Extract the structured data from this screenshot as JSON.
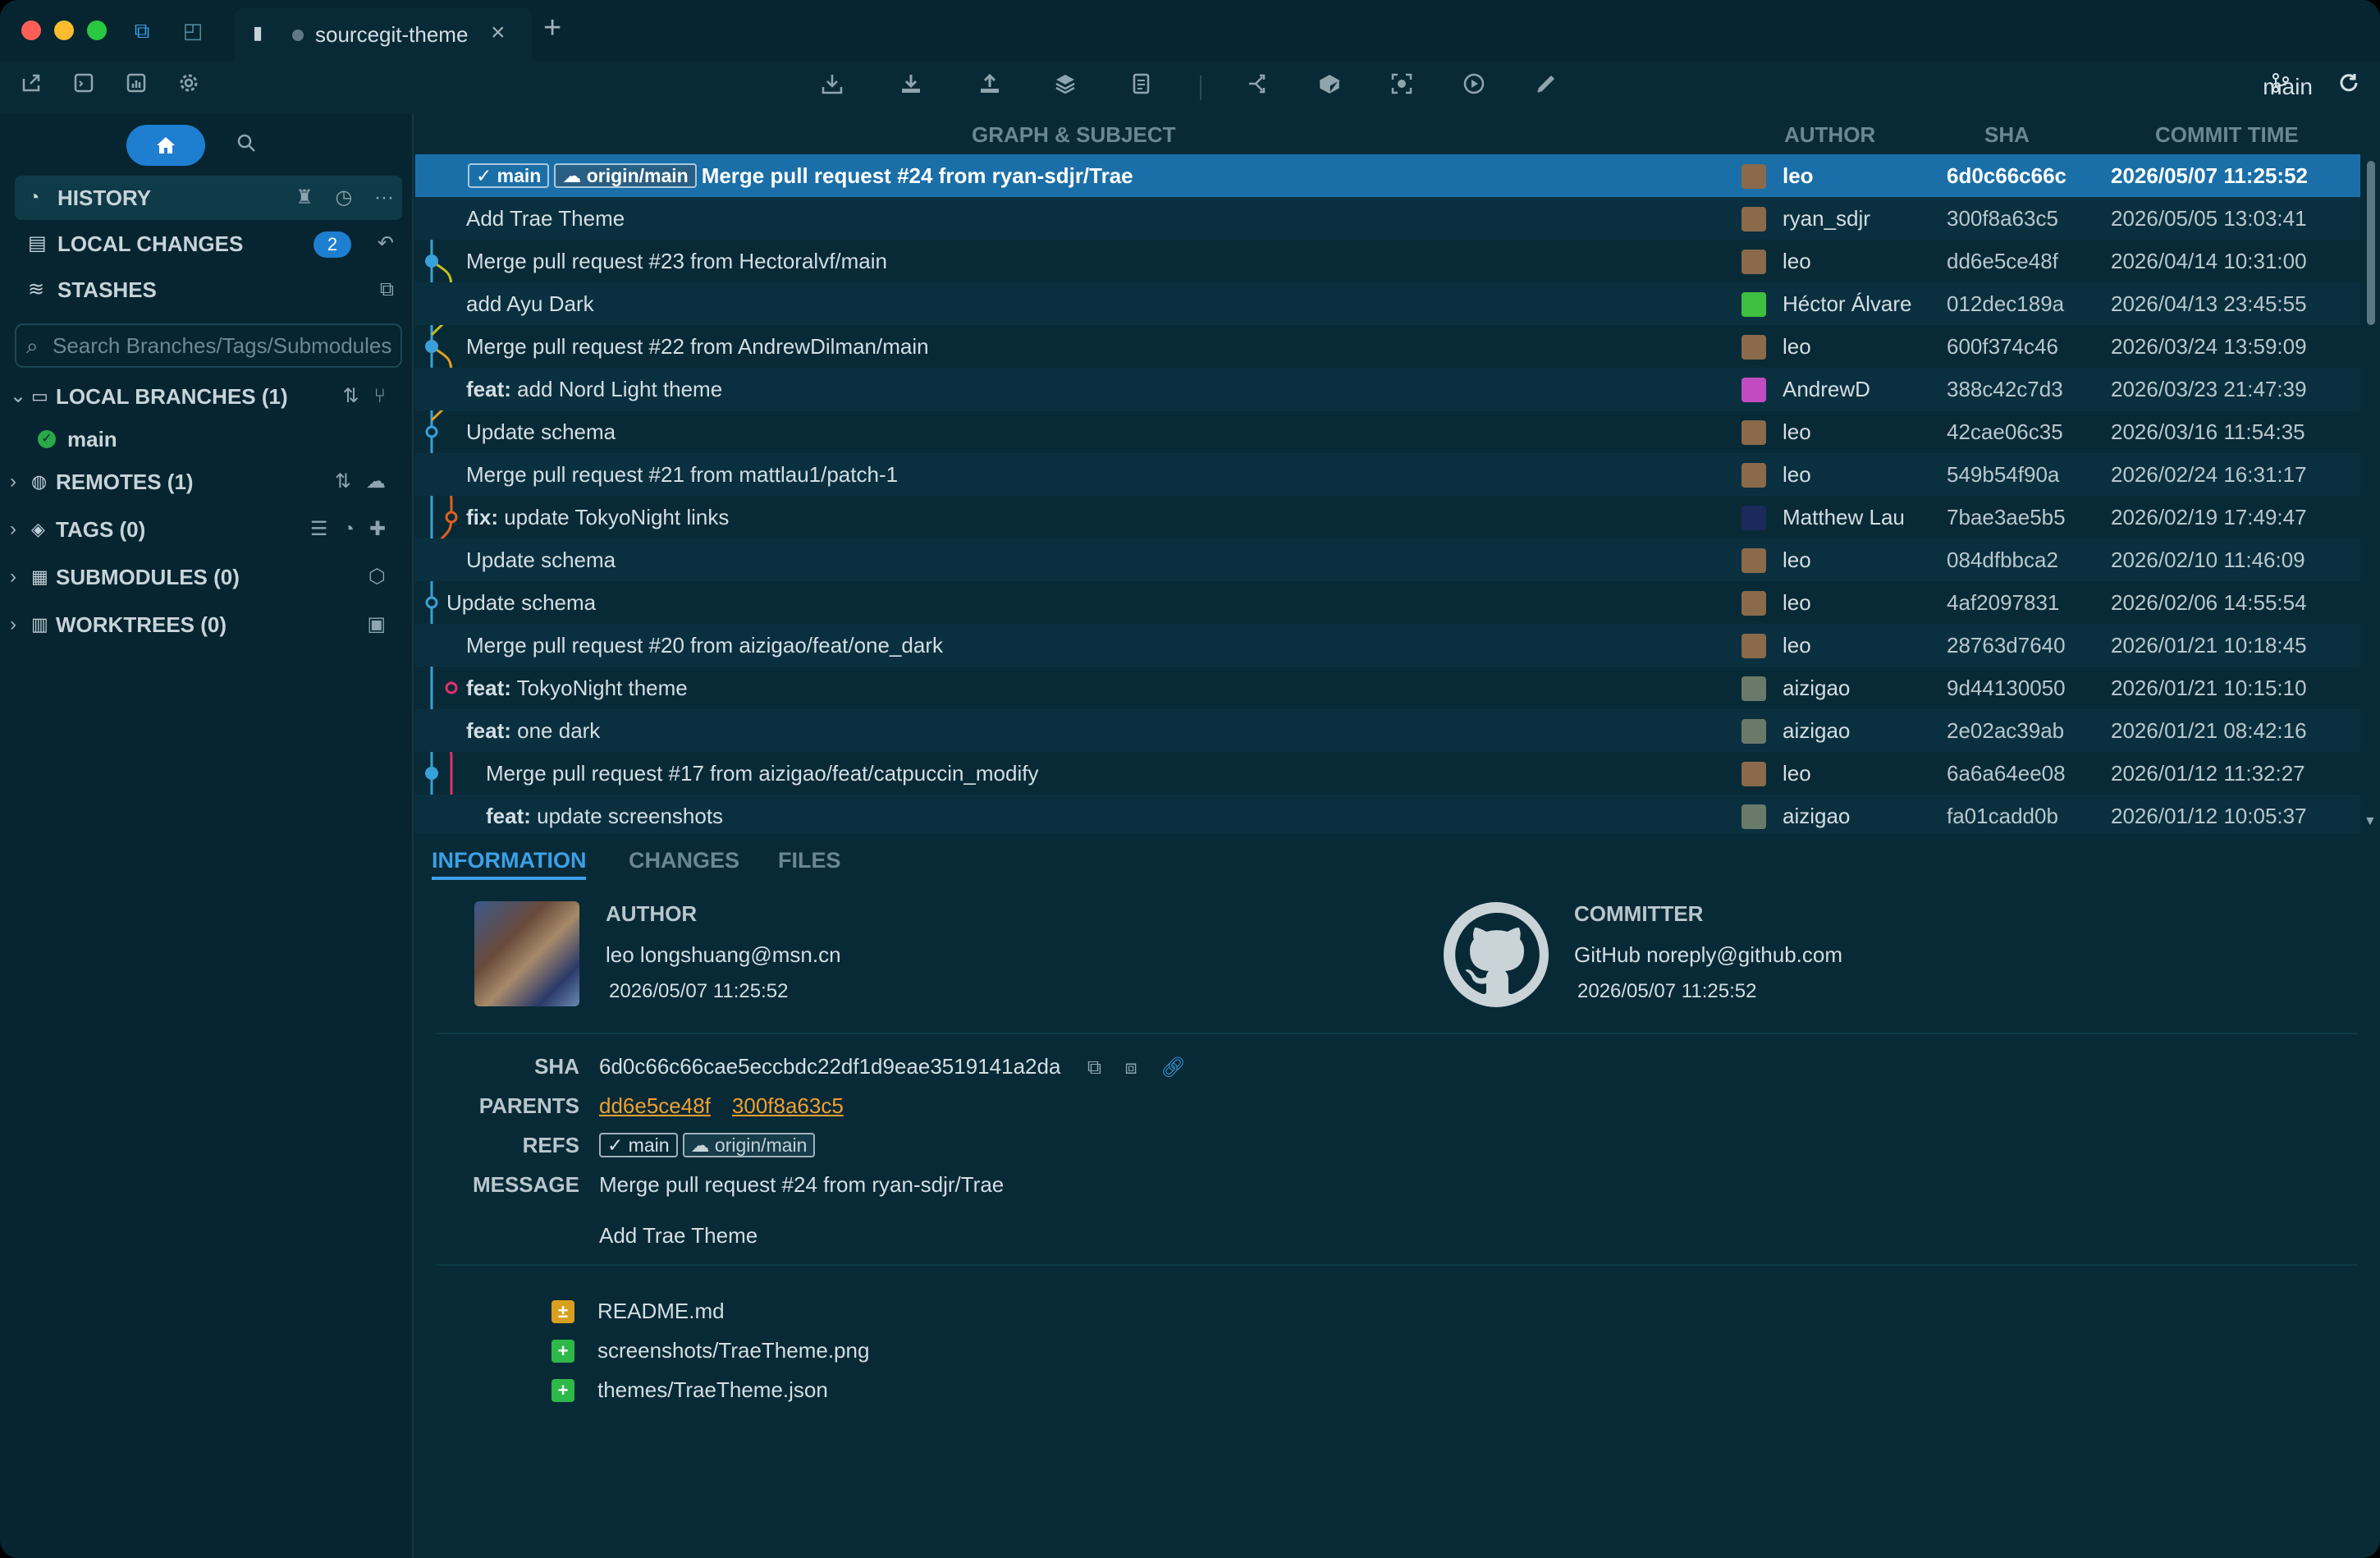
{
  "window": {
    "tab_title": "sourcegit-theme",
    "new_tab_label": "+",
    "close_label": "×"
  },
  "toolbar": {
    "branch": "main"
  },
  "sidebar": {
    "nav": [
      {
        "label": "HISTORY",
        "icon": "history-icon"
      },
      {
        "label": "LOCAL CHANGES",
        "icon": "local-changes-icon",
        "badge": "2"
      },
      {
        "label": "STASHES",
        "icon": "stashes-icon"
      }
    ],
    "search_placeholder": "Search Branches/Tags/Submodules",
    "tree": [
      {
        "label": "LOCAL BRANCHES (1)",
        "expanded": true
      },
      {
        "label": "REMOTES (1)",
        "expanded": false
      },
      {
        "label": "TAGS (0)",
        "expanded": false
      },
      {
        "label": "SUBMODULES (0)",
        "expanded": false
      },
      {
        "label": "WORKTREES (0)",
        "expanded": false
      }
    ],
    "local_branch": "main"
  },
  "history": {
    "headers": {
      "graph_subject": "GRAPH & SUBJECT",
      "author": "AUTHOR",
      "sha": "SHA",
      "commit_time": "COMMIT TIME"
    },
    "commits": [
      {
        "refs": [
          "main",
          "origin/main"
        ],
        "prefix": "",
        "subject": "Merge pull request #24 from ryan-sdjr/Trae",
        "author": "leo",
        "sha": "6d0c66c66c",
        "time": "2026/05/07 11:25:52",
        "avatar": "#8a6a4a"
      },
      {
        "refs": [],
        "prefix": "",
        "subject": "Add Trae Theme",
        "author": "ryan_sdjr",
        "sha": "300f8a63c5",
        "time": "2026/05/05 13:03:41",
        "avatar": "#8a6a4a"
      },
      {
        "refs": [],
        "prefix": "",
        "subject": "Merge pull request #23 from Hectoralvf/main",
        "author": "leo",
        "sha": "dd6e5ce48f",
        "time": "2026/04/14 10:31:00",
        "avatar": "#8a6a4a"
      },
      {
        "refs": [],
        "prefix": "",
        "subject": "add Ayu Dark",
        "author": "Héctor Álvare",
        "sha": "012dec189a",
        "time": "2026/04/13 23:45:55",
        "avatar": "#3fbf3f"
      },
      {
        "refs": [],
        "prefix": "",
        "subject": "Merge pull request #22 from AndrewDilman/main",
        "author": "leo",
        "sha": "600f374c46",
        "time": "2026/03/24 13:59:09",
        "avatar": "#8a6a4a"
      },
      {
        "refs": [],
        "prefix": "feat:",
        "subject": " add Nord Light theme",
        "author": "AndrewD",
        "sha": "388c42c7d3",
        "time": "2026/03/23 21:47:39",
        "avatar": "#c24bc2"
      },
      {
        "refs": [],
        "prefix": "",
        "subject": "Update schema",
        "author": "leo",
        "sha": "42cae06c35",
        "time": "2026/03/16 11:54:35",
        "avatar": "#8a6a4a"
      },
      {
        "refs": [],
        "prefix": "",
        "subject": "Merge pull request #21 from mattlau1/patch-1",
        "author": "leo",
        "sha": "549b54f90a",
        "time": "2026/02/24 16:31:17",
        "avatar": "#8a6a4a"
      },
      {
        "refs": [],
        "prefix": "fix:",
        "subject": " update TokyoNight links",
        "author": "Matthew Lau",
        "sha": "7bae3ae5b5",
        "time": "2026/02/19 17:49:47",
        "avatar": "#1a2a5a"
      },
      {
        "refs": [],
        "prefix": "",
        "subject": "Update schema",
        "author": "leo",
        "sha": "084dfbbca2",
        "time": "2026/02/10 11:46:09",
        "avatar": "#8a6a4a"
      },
      {
        "refs": [],
        "prefix": "",
        "subject": "Update schema",
        "author": "leo",
        "sha": "4af2097831",
        "time": "2026/02/06 14:55:54",
        "avatar": "#8a6a4a"
      },
      {
        "refs": [],
        "prefix": "",
        "subject": "Merge pull request #20 from aizigao/feat/one_dark",
        "author": "leo",
        "sha": "28763d7640",
        "time": "2026/01/21 10:18:45",
        "avatar": "#8a6a4a"
      },
      {
        "refs": [],
        "prefix": "feat:",
        "subject": " TokyoNight theme",
        "author": "aizigao",
        "sha": "9d44130050",
        "time": "2026/01/21 10:15:10",
        "avatar": "#6a7a6a"
      },
      {
        "refs": [],
        "prefix": "feat:",
        "subject": " one dark",
        "author": "aizigao",
        "sha": "2e02ac39ab",
        "time": "2026/01/21 08:42:16",
        "avatar": "#6a7a6a"
      },
      {
        "refs": [],
        "prefix": "",
        "subject": "Merge pull request #17 from aizigao/feat/catpuccin_modify",
        "author": "leo",
        "sha": "6a6a64ee08",
        "time": "2026/01/12 11:32:27",
        "avatar": "#8a6a4a"
      },
      {
        "refs": [],
        "prefix": "feat:",
        "subject": " update screenshots",
        "author": "aizigao",
        "sha": "fa01cadd0b",
        "time": "2026/01/12 10:05:37",
        "avatar": "#6a7a6a"
      }
    ]
  },
  "details": {
    "tabs": [
      "INFORMATION",
      "CHANGES",
      "FILES"
    ],
    "author_title": "AUTHOR",
    "author_name": "leo longshuang@msn.cn",
    "author_date": "2026/05/07 11:25:52",
    "committer_title": "COMMITTER",
    "committer_name": "GitHub noreply@github.com",
    "committer_date": "2026/05/07 11:25:52",
    "sha_label": "SHA",
    "sha_value": "6d0c66c66cae5eccbdc22df1d9eae3519141a2da",
    "parents_label": "PARENTS",
    "parents": [
      "dd6e5ce48f",
      "300f8a63c5"
    ],
    "refs_label": "REFS",
    "refs": [
      "main",
      "origin/main"
    ],
    "message_label": "MESSAGE",
    "message_title": "Merge pull request #24 from ryan-sdjr/Trae",
    "message_body": "Add Trae Theme",
    "files": [
      {
        "status": "±",
        "color": "#d9a020",
        "path": "README.md"
      },
      {
        "status": "+",
        "color": "#2eb84a",
        "path": "screenshots/TraeTheme.png"
      },
      {
        "status": "+",
        "color": "#2eb84a",
        "path": "themes/TraeTheme.json"
      }
    ]
  }
}
